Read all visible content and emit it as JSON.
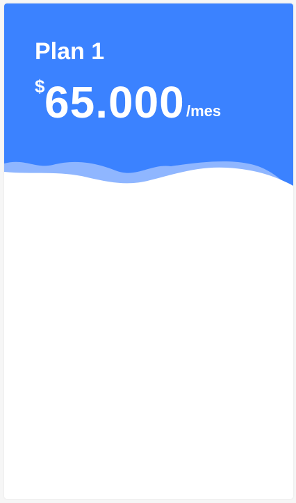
{
  "plan": {
    "name": "Plan 1",
    "currency": "$",
    "amount": "65.000",
    "period": "/mes"
  },
  "colors": {
    "header": "#3b82ff",
    "wave_back": "#8fb6ff",
    "card": "#ffffff",
    "text": "#ffffff"
  }
}
